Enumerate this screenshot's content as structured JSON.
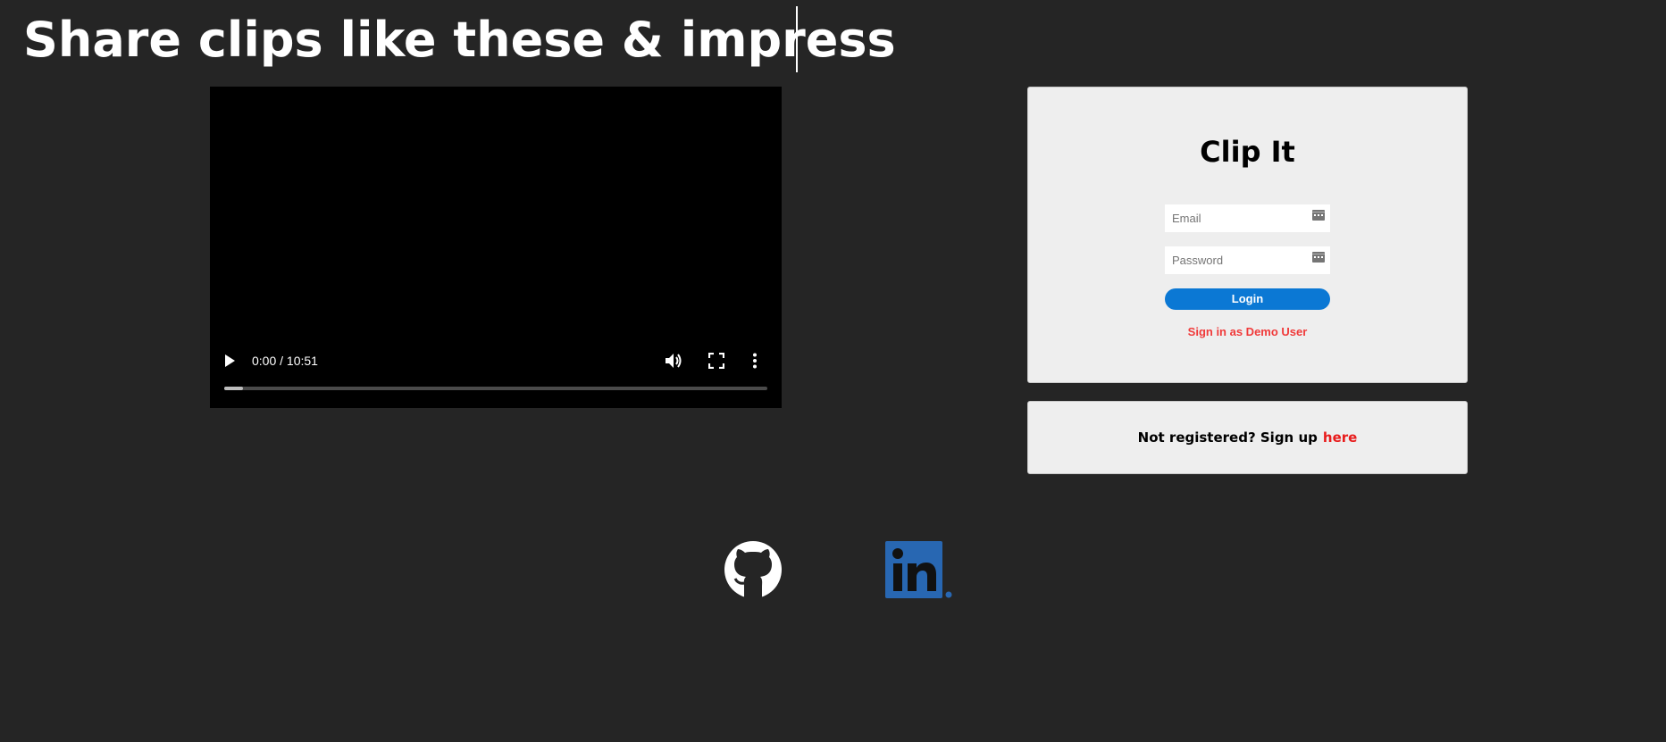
{
  "header": {
    "headline": "Share clips like these & impress"
  },
  "video": {
    "time_display": "0:00 / 10:51",
    "progress": 0.035
  },
  "login": {
    "title": "Clip It",
    "email_placeholder": "Email",
    "password_placeholder": "Password",
    "login_label": "Login",
    "demo_label": "Sign in as Demo User",
    "button_color": "#0b78d4",
    "demo_color": "#f03a3a"
  },
  "signup": {
    "prompt": "Not registered? Sign up",
    "link_label": "here",
    "link_color": "#e81c1c"
  },
  "social": {
    "github_icon": "github-icon",
    "linkedin_icon": "linkedin-icon",
    "linkedin_color": "#2867b2"
  }
}
